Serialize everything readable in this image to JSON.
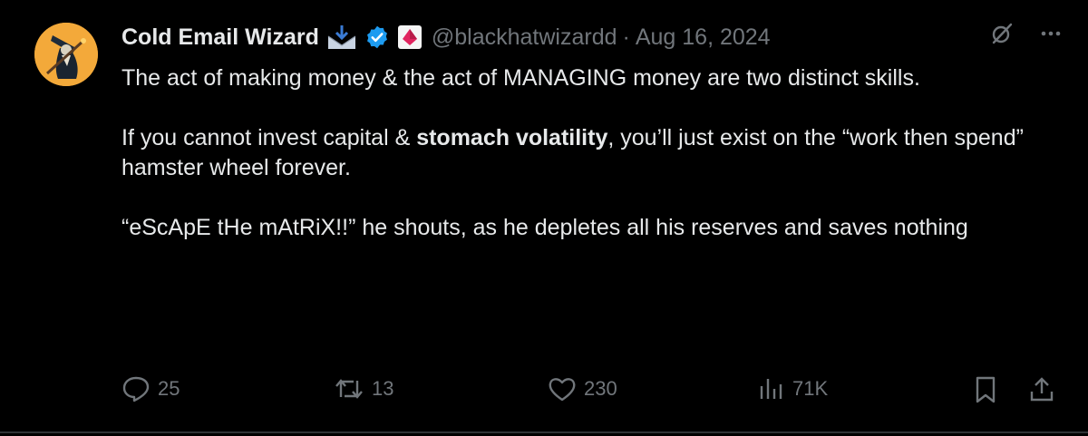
{
  "author": {
    "display_name": "Cold Email Wizard",
    "handle": "@blackhatwizardd",
    "separator": "·",
    "date": "Aug 16, 2024"
  },
  "badges": [
    "email-inbox-icon",
    "verified-badge-icon",
    "red-diamond-icon"
  ],
  "tweet": {
    "line1": "The act of making money & the act of MANAGING money are two distinct skills.",
    "line2_before": "If you cannot invest capital & ",
    "line2_bold": "stomach volatility",
    "line2_after": ", you’ll just exist on the “work then spend” hamster wheel forever.",
    "line3": "“eScApE tHe mAtRiX!!” he shouts, as he depletes all his reserves and saves nothing"
  },
  "actions": {
    "replies": "25",
    "reposts": "13",
    "likes": "230",
    "views": "71K"
  },
  "colors": {
    "background": "#000000",
    "text": "#e7e9ea",
    "muted": "#71767b",
    "verified": "#1d9bf0",
    "avatar_bg": "#f3a93a"
  }
}
